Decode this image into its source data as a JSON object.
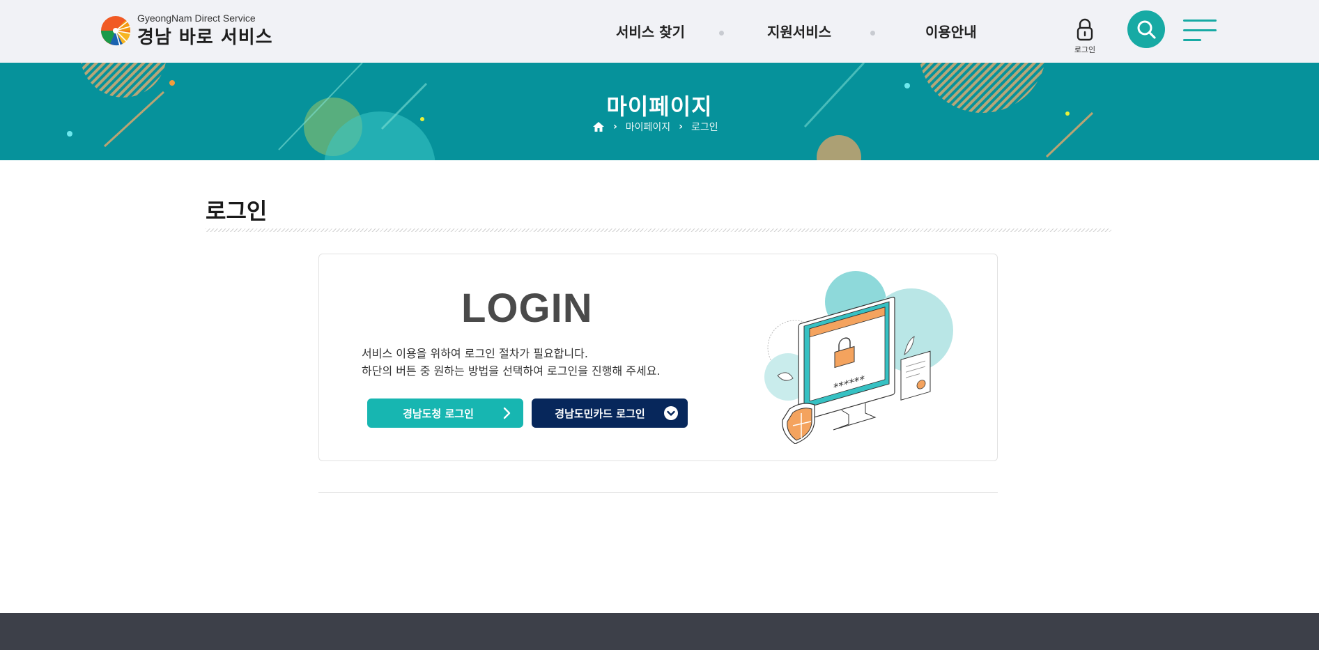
{
  "header": {
    "logo_sub": "GyeongNam Direct Service",
    "logo_main": "경남 바로 서비스",
    "nav": [
      {
        "label": "서비스 찾기"
      },
      {
        "label": "지원서비스"
      },
      {
        "label": "이용안내"
      }
    ],
    "login_label": "로그인",
    "accent_color": "#17aaa4"
  },
  "banner": {
    "title": "마이페이지",
    "breadcrumb": [
      "마이페이지",
      "로그인"
    ],
    "background_color": "#06929b"
  },
  "page": {
    "title": "로그인"
  },
  "login_box": {
    "heading": "LOGIN",
    "desc_line1": "서비스 이용을 위하여 로그인 절차가 필요합니다.",
    "desc_line2": "하단의 버튼 중 원하는 방법을 선택하여 로그인을 진행해 주세요.",
    "gov_button": "경남도청 로그인",
    "card_button": "경남도민카드 로그인",
    "illustration_password": "******"
  },
  "icons": {
    "logo": "gyeongnam-sun-logo-icon",
    "login": "lock-icon",
    "search": "search-icon",
    "menu": "hamburger-menu-icon",
    "home": "home-icon",
    "gov_button": "chevron-right-icon",
    "card_button": "chevron-down-circle-icon"
  }
}
